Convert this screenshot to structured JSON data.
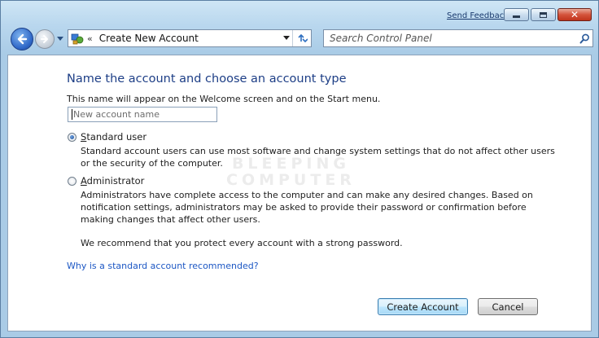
{
  "window": {
    "send_feedback": "Send Feedback",
    "caption_buttons": [
      "minimize-icon",
      "maximize-icon",
      "close-icon"
    ],
    "close_glyph": "✕"
  },
  "nav": {
    "address_separator": "«",
    "address_text": "Create New Account",
    "search_placeholder": "Search Control Panel"
  },
  "content": {
    "heading": "Name the account and choose an account type",
    "intro": "This name will appear on the Welcome screen and on the Start menu.",
    "name_field": {
      "value": "",
      "placeholder": "New account name"
    },
    "options": [
      {
        "label_underline": "S",
        "label_rest": "tandard user",
        "selected": true,
        "description": "Standard account users can use most software and change system settings that do not affect other users or the security of the computer."
      },
      {
        "label_underline": "A",
        "label_rest": "dministrator",
        "selected": false,
        "description": "Administrators have complete access to the computer and can make any desired changes. Based on notification settings, administrators may be asked to provide their password or confirmation before making changes that affect other users."
      }
    ],
    "recommendation": "We recommend that you protect every account with a strong password.",
    "help_link": "Why is a standard account recommended?",
    "watermark_line1": "BLEEPING",
    "watermark_line2": "COMPUTER"
  },
  "footer": {
    "create_button": "Create Account",
    "cancel_button": "Cancel"
  },
  "colors": {
    "heading": "#1d3e86",
    "link": "#1c57c4",
    "chrome": "#a9cbe6"
  }
}
